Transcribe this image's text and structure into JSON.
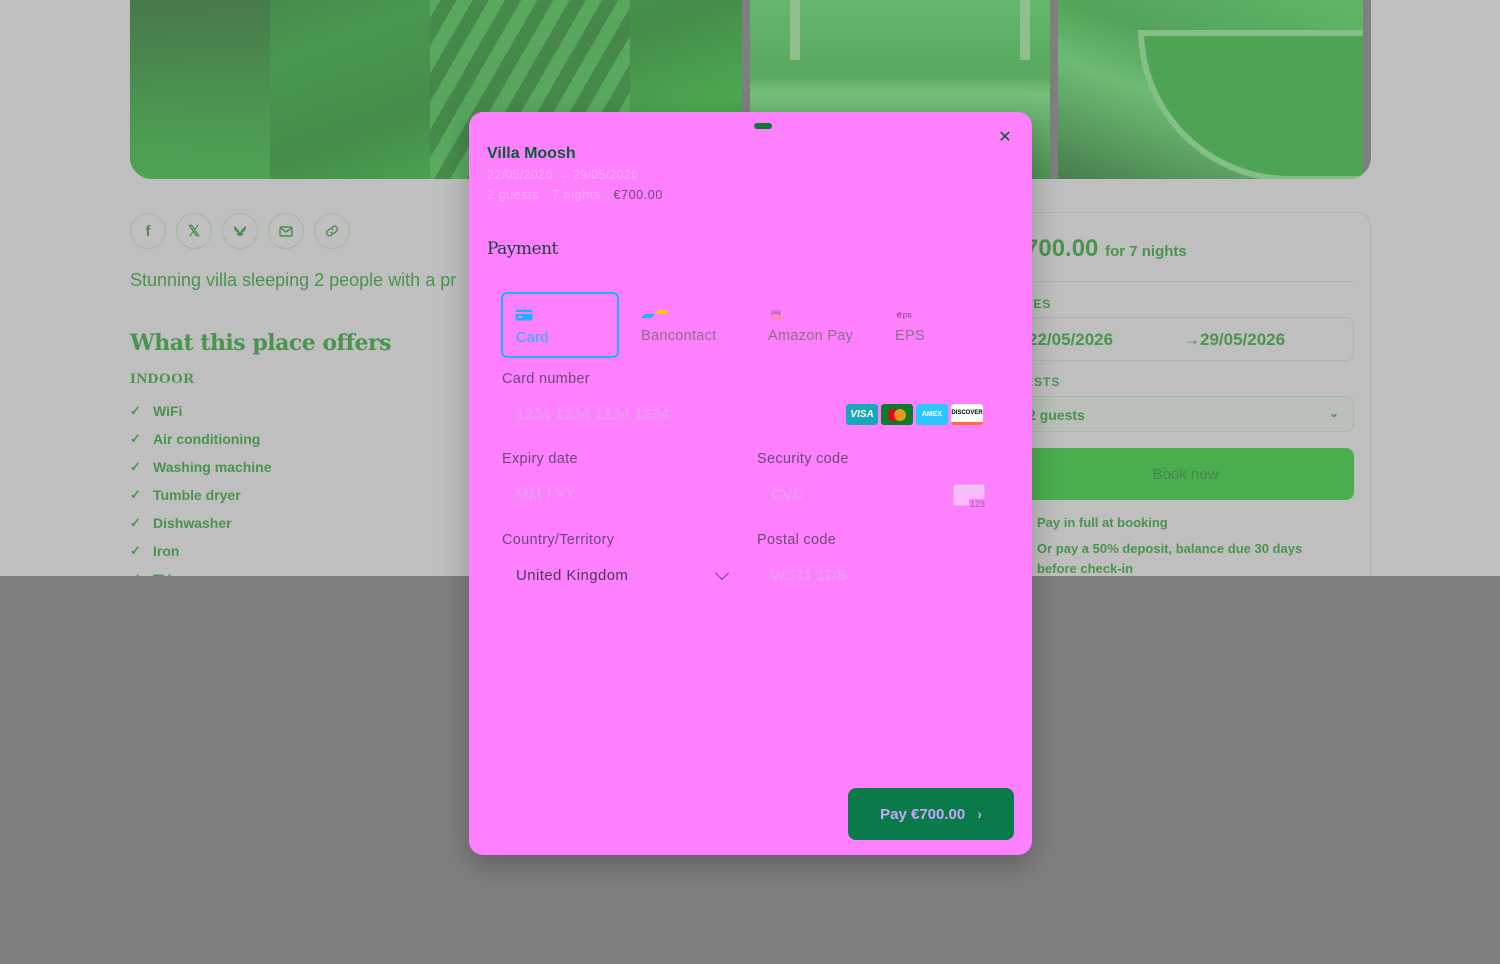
{
  "background": {
    "share_icons": [
      "facebook-icon",
      "x-icon",
      "bluesky-icon",
      "mail-icon",
      "link-icon"
    ],
    "tagline": "Stunning villa sleeping 2 people with a pr",
    "offers_title": "What this place offers",
    "indoor_label": "INDOOR",
    "amenities": [
      "WiFi",
      "Air conditioning",
      "Washing machine",
      "Tumble dryer",
      "Dishwasher",
      "Iron",
      "TV"
    ],
    "booking": {
      "price": "700.00",
      "price_suffix": "for 7 nights",
      "dates_label": "TES",
      "check_in": "22/05/2026",
      "check_out": "29/05/2026",
      "guests_label": "ESTS",
      "guests_value": "2 guests",
      "book_now": "Book now",
      "note_full": "Pay in full at booking",
      "note_deposit_pre": "Or pay a ",
      "note_deposit_pct": "50%",
      "note_deposit_post": " deposit, balance due 30 days before check-in"
    }
  },
  "modal": {
    "title": "Villa Moosh",
    "date_range": "22/05/2026 → 29/05/2026",
    "guests": "2 guests",
    "nights": "7 nights",
    "separator": "·",
    "price": "€700.00",
    "payment_heading": "Payment",
    "tabs": [
      {
        "label": "Card",
        "icon": "card-icon",
        "active": true
      },
      {
        "label": "Bancontact",
        "icon": "bancontact-icon",
        "active": false
      },
      {
        "label": "Amazon Pay",
        "icon": "amazon-pay-icon",
        "active": false
      },
      {
        "label": "EPS",
        "icon": "eps-icon",
        "active": false
      }
    ],
    "card_number_label": "Card number",
    "card_number_placeholder": "1234 1234 1234 1234",
    "card_brands": [
      "VISA",
      "MC",
      "AMEX",
      "DISCOVER"
    ],
    "expiry_label": "Expiry date",
    "expiry_placeholder": "MM / YY",
    "security_label": "Security code",
    "security_placeholder": "CVC",
    "cvc_hint": "123",
    "country_label": "Country/Territory",
    "country_value": "United Kingdom",
    "postal_label": "Postal code",
    "postal_placeholder": "WS11 1DB",
    "pay_button": "Pay €700.00"
  },
  "colors": {
    "modal_bg": "#ff80ff",
    "accent": "#1fb1ff",
    "pay_button": "#0a7a4a",
    "page_green": "#14a81d"
  }
}
